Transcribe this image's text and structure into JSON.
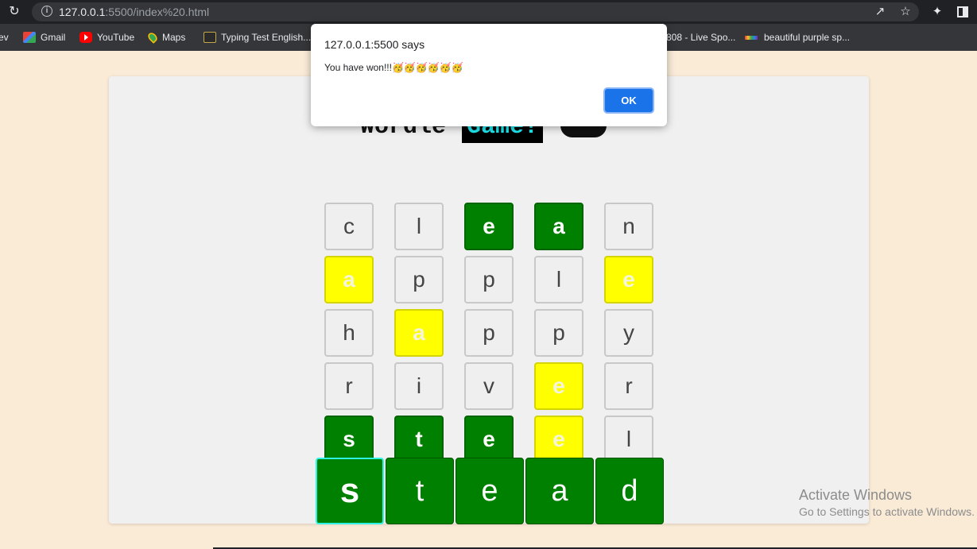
{
  "browser": {
    "url_host": "127.0.0.1",
    "url_rest": ":5500/index%20.html",
    "bookmarks": [
      {
        "label": "ev",
        "icon": "none"
      },
      {
        "label": "Gmail",
        "icon": "gmail-icon"
      },
      {
        "label": "YouTube",
        "icon": "youtube-icon"
      },
      {
        "label": "Maps",
        "icon": "maps-icon"
      },
      {
        "label": "Typing Test English...",
        "icon": "typing-test-icon"
      },
      {
        "label": "808 - Live Spo...",
        "icon": "none"
      },
      {
        "label": "beautiful purple sp...",
        "icon": "color-bar-icon"
      }
    ]
  },
  "page": {
    "title_text": "Wordle",
    "title_accent": "Game!",
    "board": [
      [
        {
          "l": "c",
          "s": "empty"
        },
        {
          "l": "l",
          "s": "empty"
        },
        {
          "l": "e",
          "s": "green"
        },
        {
          "l": "a",
          "s": "green"
        },
        {
          "l": "n",
          "s": "empty"
        }
      ],
      [
        {
          "l": "a",
          "s": "yellow"
        },
        {
          "l": "p",
          "s": "empty"
        },
        {
          "l": "p",
          "s": "empty"
        },
        {
          "l": "l",
          "s": "empty"
        },
        {
          "l": "e",
          "s": "yellow"
        }
      ],
      [
        {
          "l": "h",
          "s": "empty"
        },
        {
          "l": "a",
          "s": "yellow"
        },
        {
          "l": "p",
          "s": "empty"
        },
        {
          "l": "p",
          "s": "empty"
        },
        {
          "l": "y",
          "s": "empty"
        }
      ],
      [
        {
          "l": "r",
          "s": "empty"
        },
        {
          "l": "i",
          "s": "empty"
        },
        {
          "l": "v",
          "s": "empty"
        },
        {
          "l": "e",
          "s": "yellow"
        },
        {
          "l": "r",
          "s": "empty"
        }
      ],
      [
        {
          "l": "s",
          "s": "green"
        },
        {
          "l": "t",
          "s": "green"
        },
        {
          "l": "e",
          "s": "green"
        },
        {
          "l": "e",
          "s": "yellow"
        },
        {
          "l": "l",
          "s": "empty"
        }
      ]
    ],
    "answer_keys": [
      "s",
      "t",
      "e",
      "a",
      "d"
    ]
  },
  "dialog": {
    "origin": "127.0.0.1:5500 says",
    "message": "You have won!!!🥳🥳🥳🥳🥳🥳",
    "ok_label": "OK"
  },
  "watermark": {
    "title": "Activate Windows",
    "subtitle": "Go to Settings to activate Windows."
  },
  "colors": {
    "green": "#008000",
    "yellow": "#ffff00",
    "accent_cyan": "#1de9f0",
    "page_bg": "#faebd7"
  }
}
